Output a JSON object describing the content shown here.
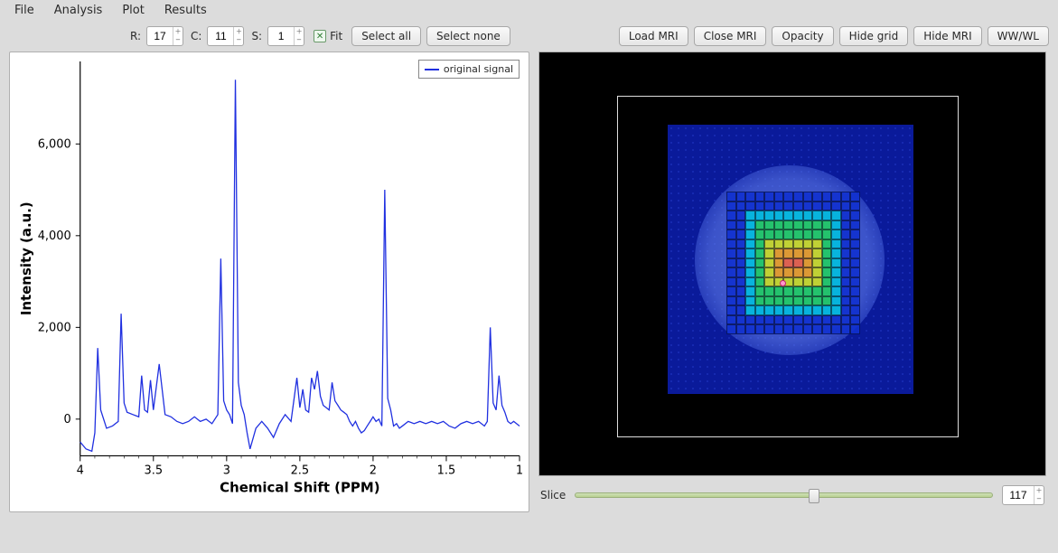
{
  "menu": {
    "file": "File",
    "analysis": "Analysis",
    "plot": "Plot",
    "results": "Results"
  },
  "controls": {
    "r_label": "R:",
    "r_value": "17",
    "c_label": "C:",
    "c_value": "11",
    "s_label": "S:",
    "s_value": "1",
    "fit_label": "Fit",
    "select_all": "Select all",
    "select_none": "Select none"
  },
  "mri_buttons": {
    "load": "Load MRI",
    "close": "Close MRI",
    "opacity": "Opacity",
    "hide_grid": "Hide grid",
    "hide_mri": "Hide MRI",
    "wwwl": "WW/WL"
  },
  "slice": {
    "label": "Slice",
    "value": "117"
  },
  "chart_data": {
    "type": "line",
    "title": "",
    "xlabel": "Chemical Shift (PPM)",
    "ylabel": "Intensity (a.u.)",
    "xlim": [
      4.0,
      1.0
    ],
    "ylim": [
      -800,
      7800
    ],
    "xticks": [
      4.0,
      3.5,
      3.0,
      2.5,
      2.0,
      1.5,
      1.0
    ],
    "yticks": [
      0,
      2000,
      4000,
      6000
    ],
    "ytick_labels": [
      "0",
      "2,000",
      "4,000",
      "6,000"
    ],
    "legend": [
      "original signal"
    ],
    "series": [
      {
        "name": "original signal",
        "x": [
          4.0,
          3.96,
          3.92,
          3.9,
          3.88,
          3.86,
          3.82,
          3.78,
          3.74,
          3.72,
          3.7,
          3.68,
          3.64,
          3.6,
          3.58,
          3.56,
          3.54,
          3.52,
          3.5,
          3.46,
          3.42,
          3.38,
          3.34,
          3.3,
          3.26,
          3.22,
          3.18,
          3.14,
          3.1,
          3.06,
          3.04,
          3.02,
          3.0,
          2.98,
          2.96,
          2.94,
          2.92,
          2.9,
          2.88,
          2.86,
          2.84,
          2.8,
          2.76,
          2.72,
          2.68,
          2.64,
          2.6,
          2.56,
          2.52,
          2.5,
          2.48,
          2.46,
          2.44,
          2.42,
          2.4,
          2.38,
          2.36,
          2.34,
          2.32,
          2.3,
          2.28,
          2.26,
          2.24,
          2.22,
          2.2,
          2.18,
          2.16,
          2.14,
          2.12,
          2.1,
          2.08,
          2.06,
          2.04,
          2.02,
          2.0,
          1.98,
          1.96,
          1.94,
          1.92,
          1.9,
          1.88,
          1.86,
          1.84,
          1.82,
          1.8,
          1.76,
          1.72,
          1.68,
          1.64,
          1.6,
          1.56,
          1.52,
          1.48,
          1.44,
          1.4,
          1.36,
          1.32,
          1.28,
          1.24,
          1.22,
          1.2,
          1.18,
          1.16,
          1.14,
          1.12,
          1.1,
          1.08,
          1.06,
          1.04,
          1.02,
          1.0
        ],
        "y": [
          -500,
          -650,
          -700,
          -300,
          1550,
          200,
          -200,
          -150,
          -50,
          2300,
          350,
          150,
          100,
          50,
          950,
          200,
          150,
          850,
          200,
          1200,
          100,
          50,
          -50,
          -100,
          -50,
          50,
          -50,
          0,
          -100,
          100,
          3500,
          400,
          200,
          100,
          -100,
          7400,
          800,
          300,
          100,
          -300,
          -650,
          -200,
          -50,
          -200,
          -400,
          -100,
          100,
          -50,
          900,
          250,
          650,
          200,
          150,
          900,
          650,
          1050,
          500,
          300,
          250,
          200,
          800,
          400,
          300,
          200,
          150,
          100,
          -50,
          -150,
          -50,
          -200,
          -300,
          -250,
          -150,
          -50,
          50,
          -50,
          0,
          -150,
          5000,
          450,
          200,
          -150,
          -100,
          -200,
          -150,
          -50,
          -100,
          -50,
          -100,
          -50,
          -100,
          -50,
          -150,
          -200,
          -100,
          -50,
          -100,
          -50,
          -150,
          -50,
          2000,
          350,
          200,
          950,
          300,
          150,
          -50,
          -100,
          -50,
          -100,
          -150
        ]
      }
    ]
  }
}
